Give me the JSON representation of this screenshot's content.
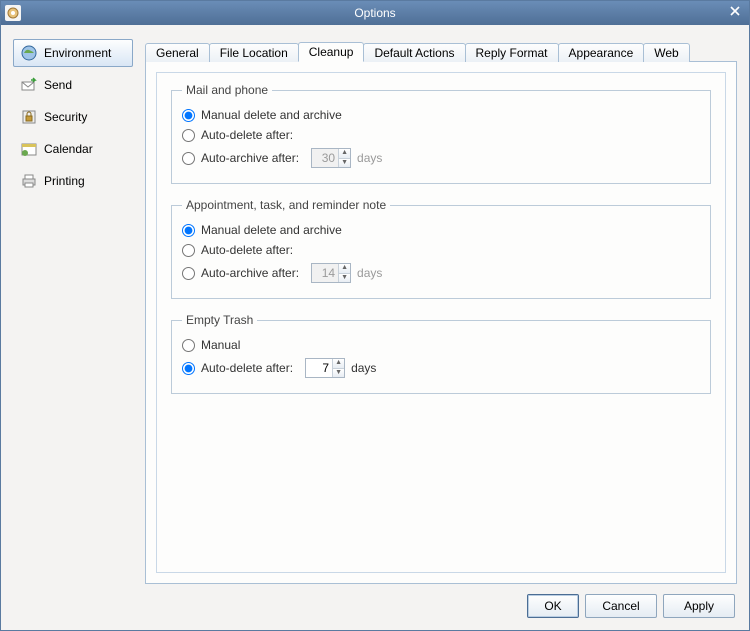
{
  "window": {
    "title": "Options"
  },
  "sidebar": {
    "items": [
      {
        "label": "Environment",
        "selected": true
      },
      {
        "label": "Send"
      },
      {
        "label": "Security"
      },
      {
        "label": "Calendar"
      },
      {
        "label": "Printing"
      }
    ]
  },
  "tabs": [
    {
      "label": "General"
    },
    {
      "label": "File Location"
    },
    {
      "label": "Cleanup",
      "active": true
    },
    {
      "label": "Default Actions"
    },
    {
      "label": "Reply Format"
    },
    {
      "label": "Appearance"
    },
    {
      "label": "Web"
    }
  ],
  "groups": {
    "mail": {
      "legend": "Mail and phone",
      "opt_manual": "Manual delete and archive",
      "opt_autodelete": "Auto-delete after:",
      "opt_autoarchive": "Auto-archive after:",
      "days_value": "30",
      "days_unit": "days"
    },
    "appt": {
      "legend": "Appointment, task, and reminder note",
      "opt_manual": "Manual delete and archive",
      "opt_autodelete": "Auto-delete after:",
      "opt_autoarchive": "Auto-archive after:",
      "days_value": "14",
      "days_unit": "days"
    },
    "trash": {
      "legend": "Empty Trash",
      "opt_manual": "Manual",
      "opt_autodelete": "Auto-delete after:",
      "days_value": "7",
      "days_unit": "days"
    }
  },
  "buttons": {
    "ok": "OK",
    "cancel": "Cancel",
    "apply": "Apply"
  }
}
